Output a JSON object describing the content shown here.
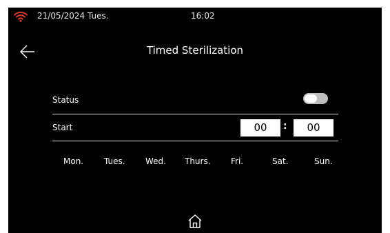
{
  "status_bar": {
    "wifi_icon": "wifi-icon",
    "wifi_color": "#d23a2c",
    "date": "21/05/2024 Tues.",
    "time": "16:02"
  },
  "header": {
    "back_icon": "arrow-left-icon",
    "title": "Timed Sterilization"
  },
  "status_row": {
    "label": "Status",
    "toggle_on": false
  },
  "start_row": {
    "label": "Start",
    "hour": "00",
    "separator": ":",
    "minute": "00"
  },
  "days": [
    "Mon.",
    "Tues.",
    "Wed.",
    "Thurs.",
    "Fri.",
    "Sat.",
    "Sun."
  ],
  "footer": {
    "home_icon": "home-icon"
  },
  "colors": {
    "background": "#000000",
    "text": "#ffffff",
    "toggle_off": "#bdbdbd"
  }
}
